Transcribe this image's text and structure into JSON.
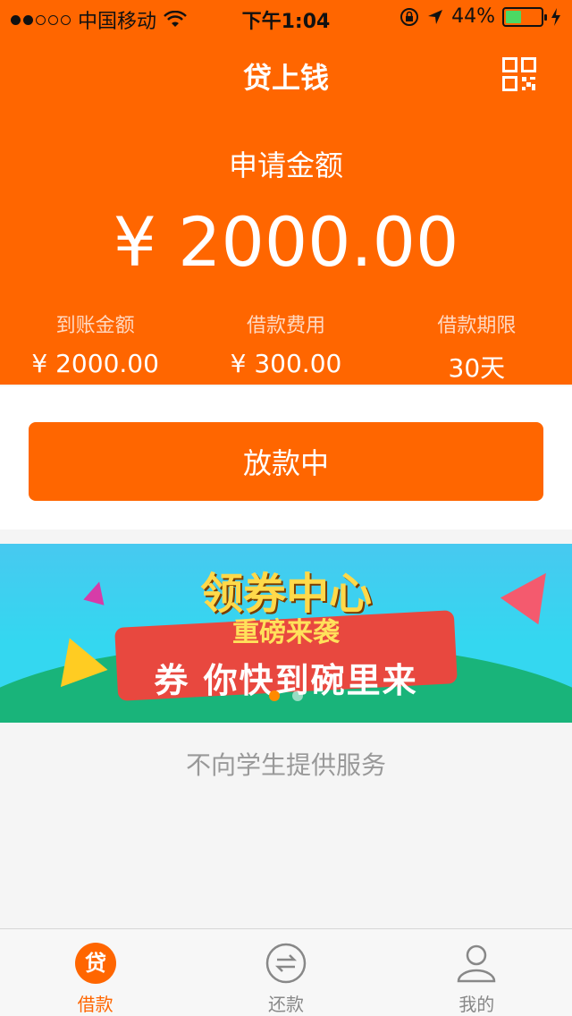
{
  "status_bar": {
    "carrier": "中国移动",
    "time": "下午1:04",
    "battery": "44%",
    "battery_level": 0.44
  },
  "header": {
    "title": "贷上钱"
  },
  "loan": {
    "apply_label": "申请金额",
    "amount": "¥ 2000.00",
    "stats": [
      {
        "label": "到账金额",
        "value": "¥ 2000.00"
      },
      {
        "label": "借款费用",
        "value": "¥ 300.00"
      },
      {
        "label": "借款期限",
        "value": "30天"
      }
    ]
  },
  "action": {
    "label": "放款中"
  },
  "banner": {
    "headline": "领券中心",
    "subline": "重磅来袭",
    "slogan": "券 你快到碗里来",
    "pages": 2,
    "active_page": 1
  },
  "notice": "不向学生提供服务",
  "tabs": [
    {
      "label": "借款",
      "icon": "loan-icon",
      "icon_glyph": "贷",
      "active": true
    },
    {
      "label": "还款",
      "icon": "repay-icon",
      "active": false
    },
    {
      "label": "我的",
      "icon": "profile-icon",
      "active": false
    }
  ],
  "colors": {
    "brand": "#ff6600",
    "banner_sky": "#47c9f0",
    "banner_hill": "#19b47a",
    "ribbon": "#e8483f"
  }
}
